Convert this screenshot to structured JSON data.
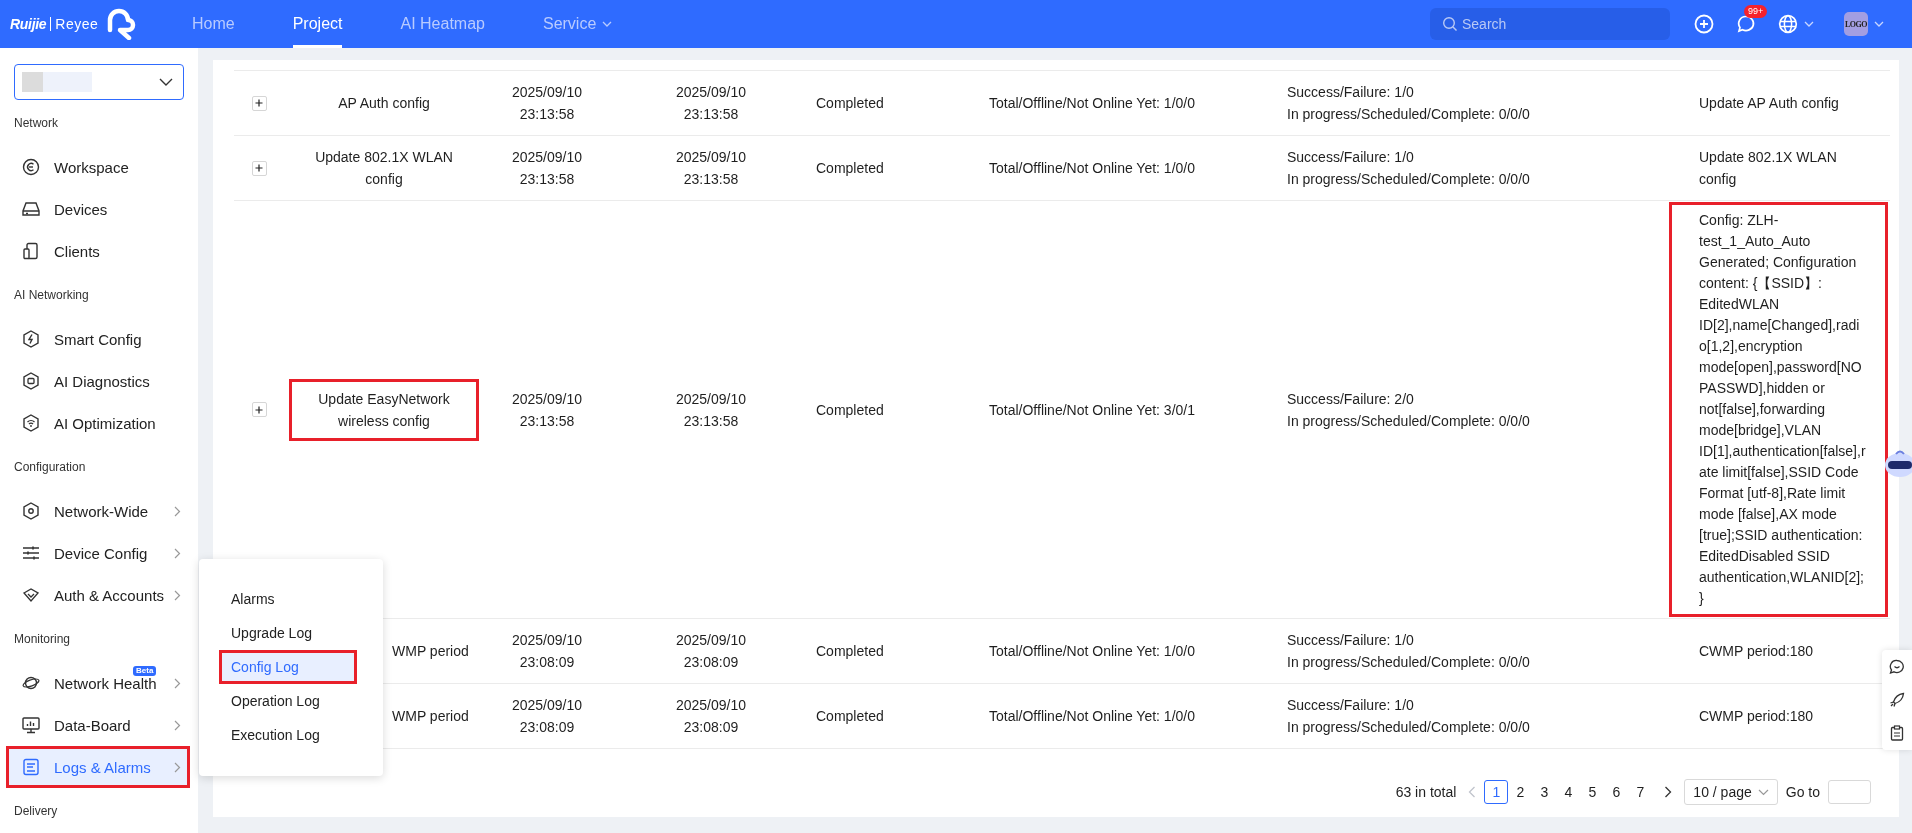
{
  "header": {
    "logo": {
      "brand": "Ruijie",
      "product": "Reyee"
    },
    "nav": [
      {
        "label": "Home",
        "selected": false,
        "has_dropdown": false
      },
      {
        "label": "Project",
        "selected": true,
        "has_dropdown": false
      },
      {
        "label": "AI Heatmap",
        "selected": false,
        "has_dropdown": false
      },
      {
        "label": "Service",
        "selected": false,
        "has_dropdown": true
      }
    ],
    "search": {
      "placeholder": "Search"
    },
    "notifications_badge": "99+",
    "avatar_text": "LOGO"
  },
  "sidebar": {
    "sections": [
      {
        "title": "Network",
        "items": [
          {
            "label": "Workspace",
            "selected": false,
            "has_submenu": false,
            "highlighted": false
          },
          {
            "label": "Devices",
            "selected": false,
            "has_submenu": false,
            "highlighted": false
          },
          {
            "label": "Clients",
            "selected": false,
            "has_submenu": false,
            "highlighted": false
          }
        ]
      },
      {
        "title": "AI Networking",
        "items": [
          {
            "label": "Smart Config",
            "selected": false,
            "has_submenu": false,
            "highlighted": false
          },
          {
            "label": "AI Diagnostics",
            "selected": false,
            "has_submenu": false,
            "highlighted": false
          },
          {
            "label": "AI Optimization",
            "selected": false,
            "has_submenu": false,
            "highlighted": false
          }
        ]
      },
      {
        "title": "Configuration",
        "items": [
          {
            "label": "Network-Wide",
            "selected": false,
            "has_submenu": true,
            "highlighted": false
          },
          {
            "label": "Device Config",
            "selected": false,
            "has_submenu": true,
            "highlighted": false
          },
          {
            "label": "Auth & Accounts",
            "selected": false,
            "has_submenu": true,
            "highlighted": false
          }
        ]
      },
      {
        "title": "Monitoring",
        "items": [
          {
            "label": "Network Health",
            "selected": false,
            "has_submenu": true,
            "highlighted": false,
            "badge": "Beta"
          },
          {
            "label": "Data-Board",
            "selected": false,
            "has_submenu": true,
            "highlighted": false
          },
          {
            "label": "Logs & Alarms",
            "selected": true,
            "has_submenu": true,
            "highlighted": true
          }
        ]
      },
      {
        "title": "Delivery"
      }
    ]
  },
  "flyout_menu": {
    "items": [
      {
        "label": "Alarms",
        "selected": false,
        "highlighted": false
      },
      {
        "label": "Upgrade Log",
        "selected": false,
        "highlighted": false
      },
      {
        "label": "Config Log",
        "selected": true,
        "highlighted": true
      },
      {
        "label": "Operation Log",
        "selected": false,
        "highlighted": false
      },
      {
        "label": "Execution Log",
        "selected": false,
        "highlighted": false
      }
    ]
  },
  "table": {
    "rows": [
      {
        "kind": "full",
        "name": "AP Auth config",
        "name_highlighted": false,
        "start_time": "2025/09/10 23:13:58",
        "end_time": "2025/09/10 23:13:58",
        "status": "Completed",
        "devices": "Total/Offline/Not Online Yet: 1/0/0",
        "result": "Success/Failure: 1/0",
        "progress": "In progress/Scheduled/Complete: 0/0/0",
        "description": "Update AP Auth config",
        "description_highlighted": false
      },
      {
        "kind": "full",
        "name": "Update 802.1X WLAN config",
        "name_highlighted": false,
        "start_time": "2025/09/10 23:13:58",
        "end_time": "2025/09/10 23:13:58",
        "status": "Completed",
        "devices": "Total/Offline/Not Online Yet: 1/0/0",
        "result": "Success/Failure: 1/0",
        "progress": "In progress/Scheduled/Complete: 0/0/0",
        "description": "Update 802.1X WLAN config",
        "description_highlighted": false
      },
      {
        "kind": "full",
        "name": "Update EasyNetwork wireless config",
        "name_highlighted": true,
        "start_time": "2025/09/10 23:13:58",
        "end_time": "2025/09/10 23:13:58",
        "status": "Completed",
        "devices": "Total/Offline/Not Online Yet: 3/0/1",
        "result": "Success/Failure: 2/0",
        "progress": "In progress/Scheduled/Complete: 0/0/0",
        "description": "Config: ZLH-test_1_Auto_Auto Generated; Configuration content: {【SSID】: EditedWLAN ID[2],name[Changed],radio[1,2],encryption mode[open],password[NO PASSWD],hidden or not[false],forwarding mode[bridge],VLAN ID[1],authentication[false],rate limit[false],SSID Code Format [utf-8],Rate limit mode [false],AX mode [true];SSID authentication: EditedDisabled SSID authentication,WLANID[2];}",
        "description_highlighted": true
      },
      {
        "kind": "partly_hidden",
        "name": "WMP period",
        "name_highlighted": false,
        "start_time": "2025/09/10 23:08:09",
        "end_time": "2025/09/10 23:08:09",
        "status": "Completed",
        "devices": "Total/Offline/Not Online Yet: 1/0/0",
        "result": "Success/Failure: 1/0",
        "progress": "In progress/Scheduled/Complete: 0/0/0",
        "description": "CWMP period:180",
        "description_highlighted": false
      },
      {
        "kind": "partly_hidden",
        "name": "WMP period",
        "name_highlighted": false,
        "start_time": "2025/09/10 23:08:09",
        "end_time": "2025/09/10 23:08:09",
        "status": "Completed",
        "devices": "Total/Offline/Not Online Yet: 1/0/0",
        "result": "Success/Failure: 1/0",
        "progress": "In progress/Scheduled/Complete: 0/0/0",
        "description": "CWMP period:180",
        "description_highlighted": false
      }
    ]
  },
  "pagination": {
    "total": "63 in total",
    "pages": [
      {
        "label": "1",
        "selected": true
      },
      {
        "label": "2",
        "selected": false
      },
      {
        "label": "3",
        "selected": false
      },
      {
        "label": "4",
        "selected": false
      },
      {
        "label": "5",
        "selected": false
      },
      {
        "label": "6",
        "selected": false
      },
      {
        "label": "7",
        "selected": false
      }
    ],
    "page_size": "10 / page",
    "goto_label": "Go to"
  }
}
